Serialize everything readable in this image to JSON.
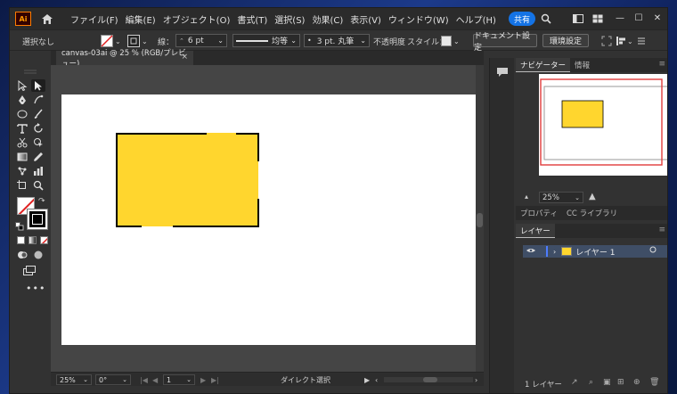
{
  "app": {
    "logo_text": "Ai",
    "menus": [
      "ファイル(F)",
      "編集(E)",
      "オブジェクト(O)",
      "書式(T)",
      "選択(S)",
      "効果(C)",
      "表示(V)",
      "ウィンドウ(W)",
      "ヘルプ(H)"
    ],
    "share_label": "共有"
  },
  "control_bar": {
    "selection_status": "選択なし",
    "stroke_label": "線：",
    "stroke_value": "6 pt",
    "profile_label": "均等",
    "brush_label": "3 pt. 丸筆",
    "opacity_label": "不透明度",
    "style_label": "スタイル：",
    "doc_setup_button": "ドキュメント設定",
    "prefs_button": "環境設定"
  },
  "document": {
    "tab_title": "canvas-03ai @ 25 % (RGB/プレビュー)",
    "close_glyph": "×"
  },
  "status_bar": {
    "zoom": "25%",
    "rotation": "0°",
    "artboard_number": "1",
    "tool_name": "ダイレクト選択"
  },
  "navigator": {
    "tabs": [
      "ナビゲーター",
      "情報"
    ],
    "zoom": "25%"
  },
  "properties": {
    "tabs": [
      "プロパティ",
      "CC ライブラリ"
    ]
  },
  "layers": {
    "tab": "レイヤー",
    "layer_name": "レイヤー 1",
    "count_label": "1 レイヤー"
  },
  "colors": {
    "fill": "#FFD62E",
    "stroke": "#000000",
    "accent": "#1473E6",
    "nav_view_rect": "#E03C3C"
  }
}
